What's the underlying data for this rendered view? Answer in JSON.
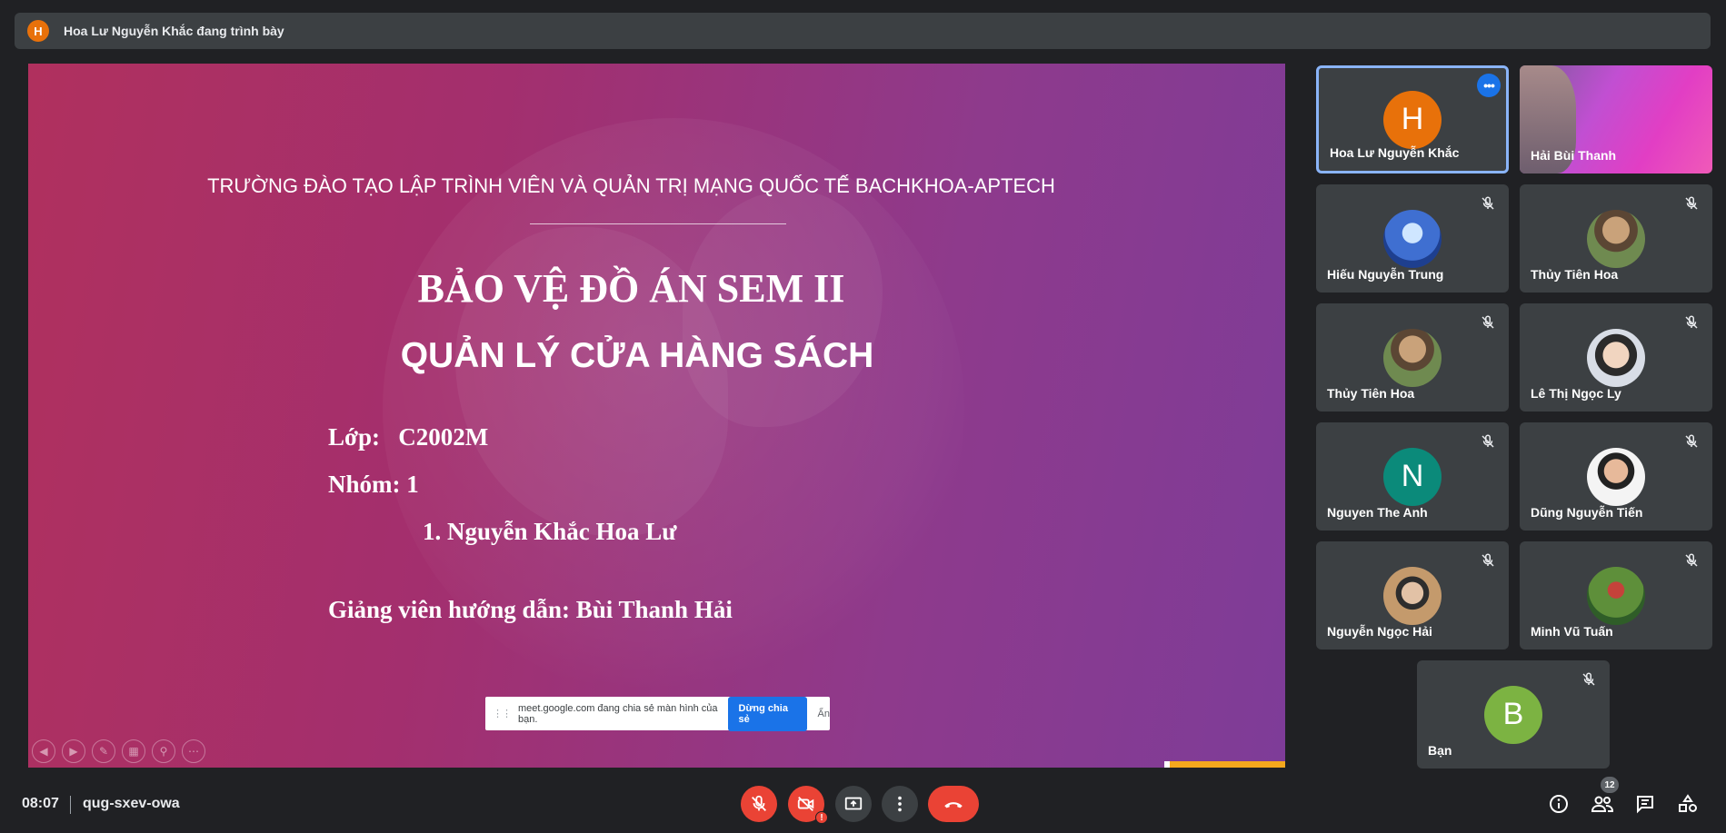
{
  "presenter": {
    "initial": "H",
    "text": "Hoa Lư Nguyễn Khắc đang trình bày"
  },
  "slide": {
    "school": "TRƯỜNG ĐÀO TẠO LẬP TRÌNH VIÊN VÀ QUẢN TRỊ MẠNG QUỐC TẾ BACHKHOA-APTECH",
    "title": "BẢO VỆ ĐỒ ÁN SEM II",
    "subtitle": "QUẢN LÝ CỬA HÀNG SÁCH",
    "class_line": "Lớp:   C2002M",
    "group_line": "Nhóm: 1",
    "member_line": "1. Nguyễn Khắc Hoa Lư",
    "advisor_line": "Giảng viên hướng dẫn: Bùi Thanh Hải"
  },
  "share_banner": {
    "message": "meet.google.com đang chia sẻ màn hình của bạn.",
    "stop_label": "Dừng chia sẻ",
    "hide_label": "Ẩn"
  },
  "participants": [
    {
      "name": "Hoa Lư Nguyễn Khắc",
      "initial": "H",
      "color": "#e8710a",
      "type": "initial",
      "active": true
    },
    {
      "name": "Hải Bùi Thanh",
      "type": "video"
    },
    {
      "name": "Hiếu Nguyễn Trung",
      "type": "photo",
      "muted": true
    },
    {
      "name": "Thủy Tiên Hoa",
      "type": "photo",
      "muted": true
    },
    {
      "name": "Thủy Tiên Hoa",
      "type": "photo",
      "muted": true
    },
    {
      "name": "Lê Thị Ngọc Ly",
      "type": "photo",
      "muted": true
    },
    {
      "name": "Nguyen The Anh",
      "initial": "N",
      "color": "#0b8a7a",
      "type": "initial",
      "muted": true
    },
    {
      "name": "Dũng Nguyễn Tiến",
      "type": "photo",
      "muted": true
    },
    {
      "name": "Nguyễn Ngọc Hải",
      "type": "photo",
      "muted": true
    },
    {
      "name": "Minh Vũ Tuấn",
      "type": "photo",
      "muted": true
    },
    {
      "name": "Bạn",
      "initial": "B",
      "color": "#7cb342",
      "type": "initial",
      "muted": true
    }
  ],
  "meeting": {
    "time": "08:07",
    "code": "qug-sxev-owa",
    "participant_count": "12"
  }
}
